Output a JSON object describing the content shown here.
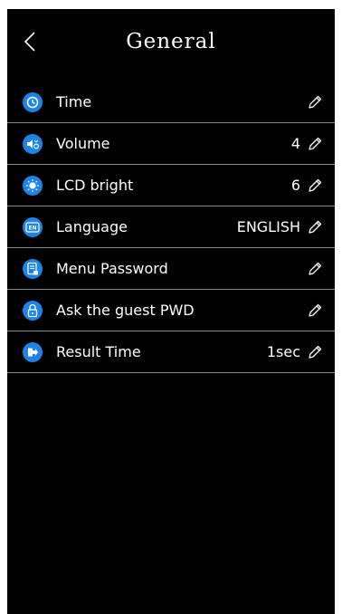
{
  "header": {
    "title": "General",
    "back_icon": "chevron-left-icon"
  },
  "colors": {
    "background": "#000000",
    "icon_accent": "#1c84e8",
    "text": "#ffffff",
    "divider": "#8a8a8a"
  },
  "settings": [
    {
      "label": "Time",
      "value": "",
      "icon": "clock-icon"
    },
    {
      "label": "Volume",
      "value": "4",
      "icon": "volume-icon"
    },
    {
      "label": "LCD bright",
      "value": "6",
      "icon": "brightness-icon"
    },
    {
      "label": "Language",
      "value": "ENGLISH",
      "icon": "language-icon"
    },
    {
      "label": "Menu Password",
      "value": "",
      "icon": "document-lock-icon"
    },
    {
      "label": "Ask the guest PWD",
      "value": "",
      "icon": "padlock-icon"
    },
    {
      "label": "Result Time",
      "value": "1sec",
      "icon": "exit-arrow-icon"
    }
  ],
  "edit_icon": "pencil-icon"
}
